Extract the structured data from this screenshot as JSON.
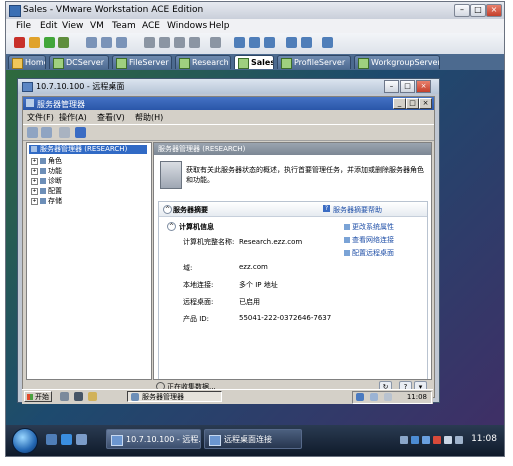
{
  "vmware": {
    "title": "Sales - VMware Workstation ACE Edition",
    "menu": [
      "File",
      "Edit",
      "View",
      "VM",
      "Team",
      "ACE",
      "Windows",
      "Help"
    ],
    "tabs": [
      {
        "label": "Home",
        "active": false
      },
      {
        "label": "DCServer",
        "active": false
      },
      {
        "label": "FileServer",
        "active": false
      },
      {
        "label": "Research",
        "active": false
      },
      {
        "label": "Sales",
        "active": true
      },
      {
        "label": "ProfileServer",
        "active": false
      },
      {
        "label": "WorkgroupServer",
        "active": false
      }
    ]
  },
  "rdp": {
    "title": "10.7.10.100 - 远程桌面"
  },
  "server_manager": {
    "title": "服务器管理器",
    "menu": [
      "文件(F)",
      "操作(A)",
      "查看(V)",
      "帮助(H)"
    ],
    "tree": {
      "root": "服务器管理器 (RESEARCH)",
      "items": [
        "角色",
        "功能",
        "诊断",
        "配置",
        "存储"
      ]
    },
    "pane_header": "服务器管理器 (RESEARCH)",
    "description": "获取有关此服务器状态的概述，执行首要管理任务，并添加或删除服务器角色和功能。",
    "summary": {
      "title": "服务器摘要",
      "help": "服务器摘要帮助",
      "computer_info_title": "计算机信息",
      "rows": [
        {
          "label": "计算机完整名称:",
          "value": "Research.ezz.com"
        },
        {
          "label": "域:",
          "value": "ezz.com"
        },
        {
          "label": "本地连接:",
          "value": "多个 IP 地址"
        },
        {
          "label": "远程桌面:",
          "value": "已启用"
        },
        {
          "label": "产品 ID:",
          "value": "55041-222-0372646-7637"
        }
      ],
      "links": [
        "更改系统属性",
        "查看网络连接",
        "配置远程桌面"
      ]
    },
    "status": "正在收集数据..."
  },
  "guest_taskbar": {
    "start": "开始",
    "task": "服务器管理器",
    "clock": "11:08"
  },
  "host_taskbar": {
    "tasks": [
      "10.7.10.100 - 远程...",
      "远程桌面连接"
    ],
    "clock": "11:08"
  }
}
